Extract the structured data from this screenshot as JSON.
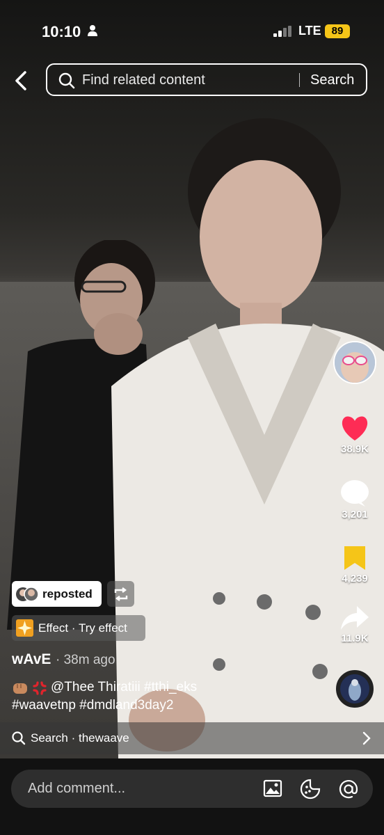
{
  "status_bar": {
    "time": "10:10",
    "network": "LTE",
    "battery": "89"
  },
  "search": {
    "placeholder": "Find related content",
    "button_label": "Search"
  },
  "right_rail": {
    "likes": "38.9K",
    "comments": "3,201",
    "saves": "4,239",
    "shares": "11.9K"
  },
  "repost": {
    "label": "reposted"
  },
  "effect": {
    "label": "Effect · Try effect"
  },
  "post": {
    "author": "wAvE",
    "time_ago": "· 38m ago",
    "caption_line1": "@Thee Thiratiii #tthi_eks",
    "caption_line2": "#waavetnp #dmdland3day2"
  },
  "related_search": {
    "label": "Search · thewaave"
  },
  "comment_bar": {
    "placeholder": "Add comment..."
  },
  "colors": {
    "like": "#fe2c55",
    "save": "#f5c518",
    "battery": "#f5c518"
  },
  "icons": [
    "person-icon",
    "signal-icon",
    "back-icon",
    "search-icon",
    "heart-icon",
    "comment-icon",
    "bookmark-icon",
    "share-icon",
    "repost-icon",
    "image-icon",
    "emoji-icon",
    "at-icon",
    "chevron-right-icon"
  ]
}
